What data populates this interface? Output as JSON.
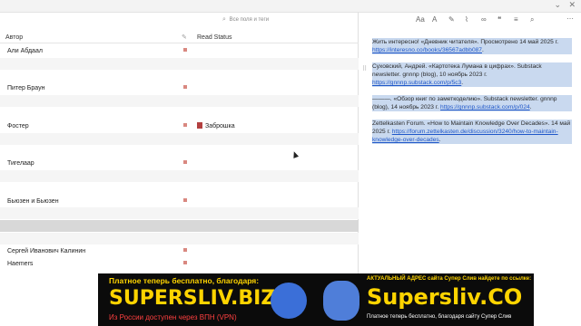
{
  "search": {
    "placeholder": "Все поля и теги"
  },
  "columns": {
    "author": "Автор",
    "read_status": "Read Status"
  },
  "rows": [
    {
      "author": "Али Абдаал",
      "status": ""
    },
    {
      "author": "",
      "status": ""
    },
    {
      "author": "",
      "status": ""
    },
    {
      "author": "Питер Браун",
      "status": ""
    },
    {
      "author": "",
      "status": ""
    },
    {
      "author": "",
      "status": ""
    },
    {
      "author": "Фостер",
      "status": "Заброшка"
    },
    {
      "author": "",
      "status": ""
    },
    {
      "author": "",
      "status": ""
    },
    {
      "author": "Тигелаар",
      "status": ""
    },
    {
      "author": "",
      "status": ""
    },
    {
      "author": "",
      "status": ""
    },
    {
      "author": "Бьюзен и Бьюзен",
      "status": ""
    },
    {
      "author": "",
      "status": ""
    },
    {
      "author": "",
      "status": ""
    },
    {
      "author": "",
      "status": ""
    },
    {
      "author": "Сергей Иванович Калинин",
      "status": ""
    },
    {
      "author": "Haemers",
      "status": ""
    }
  ],
  "references": [
    {
      "text": "Жить интересно! «Дневник читателя». Просмотрено 14 май 2025 г. ",
      "link": "https://interesno.co/books/36567adbb087"
    },
    {
      "text": "Суховский, Андрей. «Картотека Лумана в цифрах». Substack newsletter. gnnnp (blog), 10 ноябрь 2023 г. ",
      "link": "https://gnnnp.substack.com/p/5c3"
    },
    {
      "text": "———. «Обзор книг по заметкоделию». Substack newsletter. gnnnp (blog), 14 ноябрь 2023 г. ",
      "link": "https://gnnnp.substack.com/p/024"
    },
    {
      "text": "Zettelkasten Forum. «How to Maintain Knowledge Over Decades». 14 май 2025 г. ",
      "link": "https://forum.zettelkasten.de/discussion/3240/how-to-maintain-knowledge-over-decades"
    }
  ],
  "toolbar": {
    "font_label": "Aa",
    "text_label": "A"
  },
  "banner": {
    "left_top": "Платное теперь бесплатно, благодаря:",
    "left_logo": "SUPERSLIV.BIZ",
    "left_sub": "Из России доступен через ВПН (VPN)",
    "right_top": "АКТУАЛЬНЫЙ АДРЕС сайта Супер Слив найдете по ссылке:",
    "right_logo": "Supersliv.CO",
    "right_sub": "Платное теперь бесплатно, благодаря сайту Супер Слив"
  }
}
